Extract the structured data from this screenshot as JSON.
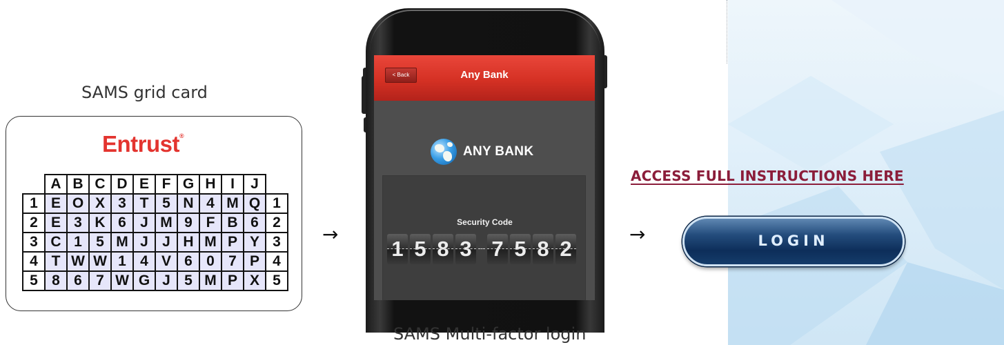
{
  "grid_card": {
    "caption": "SAMS grid card",
    "brand": "Entrust",
    "brand_mark": "®",
    "columns": [
      "A",
      "B",
      "C",
      "D",
      "E",
      "F",
      "G",
      "H",
      "I",
      "J"
    ],
    "rows": [
      {
        "num": "1",
        "cells": [
          "E",
          "O",
          "X",
          "3",
          "T",
          "5",
          "N",
          "4",
          "M",
          "Q"
        ]
      },
      {
        "num": "2",
        "cells": [
          "E",
          "3",
          "K",
          "6",
          "J",
          "M",
          "9",
          "F",
          "B",
          "6"
        ]
      },
      {
        "num": "3",
        "cells": [
          "C",
          "1",
          "5",
          "M",
          "J",
          "J",
          "H",
          "M",
          "P",
          "Y"
        ]
      },
      {
        "num": "4",
        "cells": [
          "T",
          "W",
          "W",
          "1",
          "4",
          "V",
          "6",
          "0",
          "7",
          "P"
        ]
      },
      {
        "num": "5",
        "cells": [
          "8",
          "6",
          "7",
          "W",
          "G",
          "J",
          "5",
          "M",
          "P",
          "X"
        ]
      }
    ]
  },
  "arrows": {
    "first": "→",
    "second": "→"
  },
  "phone": {
    "caption": "SAMS Multi-factor login",
    "back_label": "< Back",
    "app_title": "Any Bank",
    "bank_name": "ANY BANK",
    "security_label": "Security Code",
    "code_group_1": [
      "1",
      "5",
      "8",
      "3"
    ],
    "code_group_2": [
      "7",
      "5",
      "8",
      "2"
    ]
  },
  "access_link": "ACCESS FULL INSTRUCTIONS HERE",
  "login_label": "LOGIN",
  "colors": {
    "brand_red": "#e3342f",
    "link_maroon": "#8b1d3a",
    "login_navy": "#0d2e5a",
    "app_bar_red": "#d53124"
  }
}
